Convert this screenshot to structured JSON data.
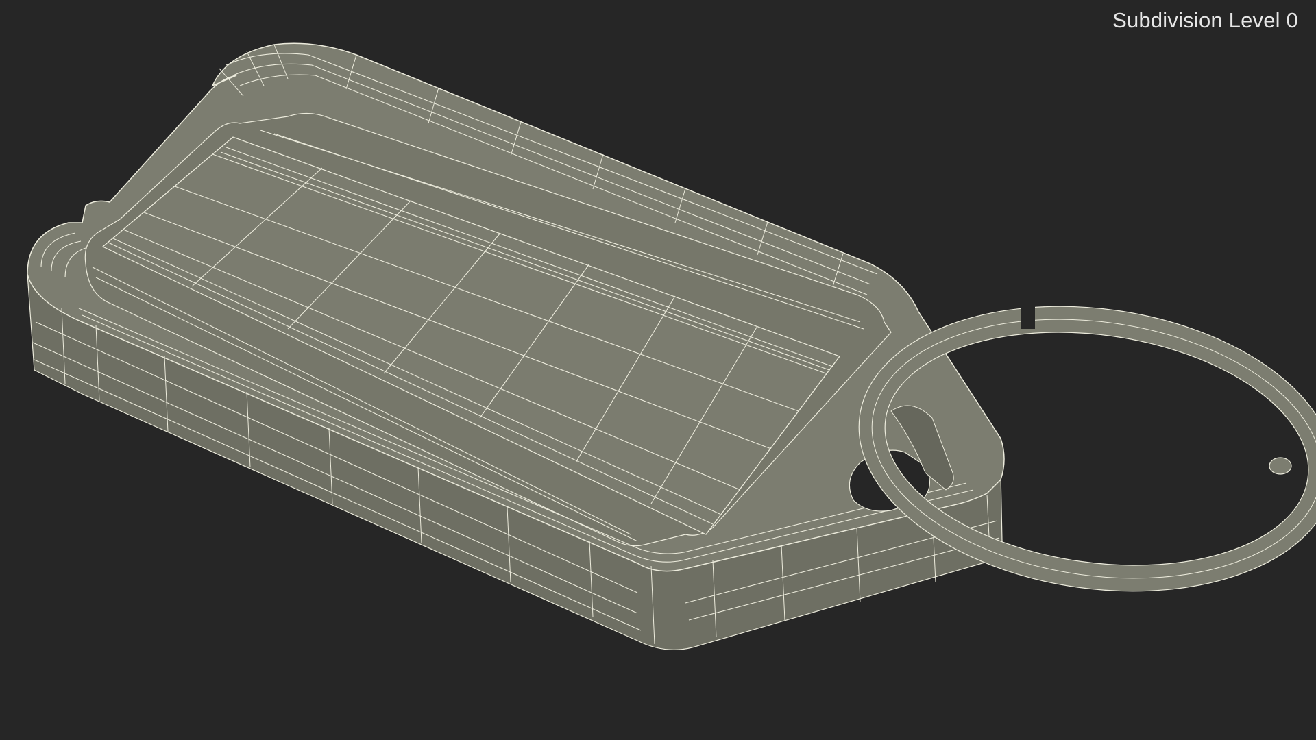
{
  "viewport": {
    "overlay_label": "Subdivision Level 0",
    "background_color": "#262626",
    "mesh_fill_color": "#7c7d70",
    "mesh_shade_color": "#6c6d61",
    "mesh_dark_color": "#5f6055",
    "wire_color": "#ecebdc",
    "ring_hole_color": "#262626"
  },
  "model": {
    "name_icon": "key-tag-wireframe-mesh",
    "parts": [
      "tag-body",
      "tag-recess",
      "tag-rim",
      "tag-hole",
      "split-key-ring"
    ]
  }
}
